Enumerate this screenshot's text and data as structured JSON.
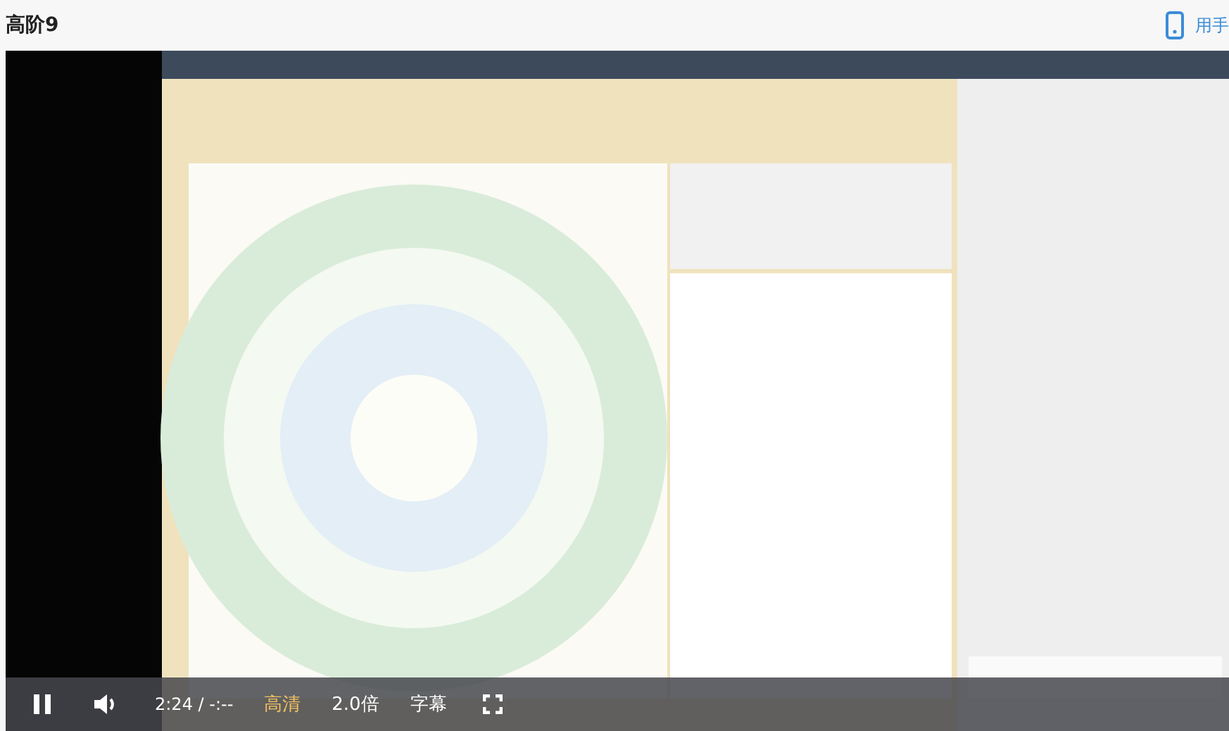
{
  "page": {
    "title": "高阶9",
    "app_link": "用手"
  },
  "player": {
    "paused": false,
    "time": "2:24 / -:--",
    "controls": [
      {
        "label": "高清",
        "highlighted": true
      },
      {
        "label": "2.0倍",
        "highlighted": false
      },
      {
        "label": "字幕",
        "highlighted": false
      }
    ]
  }
}
